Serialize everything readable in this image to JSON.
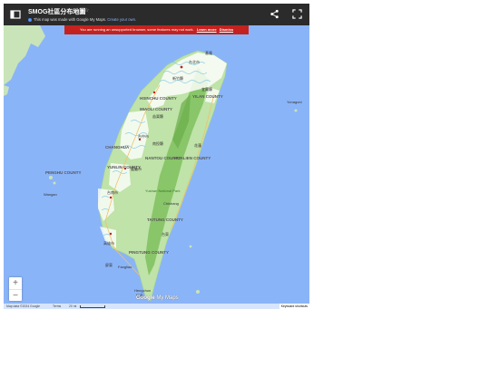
{
  "header": {
    "title": "SMOG社區分布地圖",
    "subtitle": "This map was made with Google My Maps.",
    "subtitle_link": "Create your own."
  },
  "warning": {
    "text": "You are running an unsupported browser, some features may not work.",
    "learn_more": "Learn more",
    "dismiss": "Dismiss"
  },
  "zoom": {
    "in": "+",
    "out": "−"
  },
  "footer": {
    "attribution": "Map data ©2024 Google",
    "terms": "Terms",
    "scale": "20 mi",
    "keyboard": "Keyboard shortcuts"
  },
  "branding": {
    "google": "Google",
    "mymaps": "My Maps"
  },
  "colors": {
    "water": "#8ab4f8",
    "land": "#bfe3a8",
    "mountain": "#7fbf5e",
    "overlay": "#ffffff",
    "header": "#2b2b2b",
    "warning": "#c5221f"
  },
  "map_labels": {
    "guomao": "廈門",
    "keelung": "基隆",
    "taipei": "台北市",
    "xinzhu_county": "新竹縣",
    "yilan": "宜蘭縣",
    "yilan_county": "YILAN COUNTY",
    "hsinchu_county": "HSINCHU COUNTY",
    "miaoli": "MIAOLI COUNTY",
    "miaoli_zh": "苗栗縣",
    "taichung": "台中市",
    "changhua": "CHANGHUA",
    "nantou": "NANTOU COUNTY",
    "nantou_zh": "南投縣",
    "hualien": "HUALIEN COUNTY",
    "hualien_zh": "花蓮",
    "yunlin": "YUNLIN COUNTY",
    "chiayi": "嘉義市",
    "yushan": "Yushan National Park",
    "tainan": "台南市",
    "taitung": "TAITUNG COUNTY",
    "taitung_zh": "台東",
    "kaohsiung": "高雄市",
    "pingtung": "PINGTUNG COUNTY",
    "pingtung_zh": "屏東",
    "hengchun": "Hengchun",
    "hengchun_zh": "恆春",
    "penghu": "PENGHU COUNTY",
    "wangan": "Wangan",
    "yonaguni": "Yonaguni",
    "chishang": "Chishang",
    "fangliao": "Fangliao",
    "ilan_city": "Luodong"
  }
}
